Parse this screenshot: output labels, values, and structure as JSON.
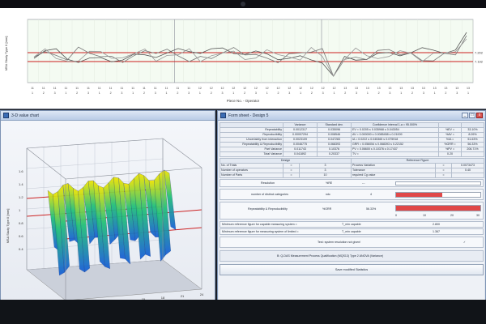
{
  "top_chart": {
    "ylabel": "MSA Study Type II [mm]",
    "xlabel": "Piece No. - Operator",
    "limit_labels": [
      "7.202",
      "7.192"
    ],
    "tick_labels": [
      "11",
      "11",
      "11",
      "11",
      "11",
      "11",
      "11",
      "11",
      "11",
      "11",
      "11",
      "11",
      "11",
      "11",
      "11",
      "12",
      "12",
      "12",
      "12",
      "12",
      "12",
      "12",
      "12",
      "12",
      "12",
      "12",
      "12",
      "12",
      "13",
      "13",
      "13",
      "13",
      "13",
      "13",
      "13",
      "13",
      "13",
      "13",
      "13",
      "13"
    ]
  },
  "left_window": {
    "title": "3-D value chart",
    "zlabel": "MSA Study Type II [mm]",
    "xlabel": "Value No. →",
    "z_ticks": [
      "1.6",
      "1.4",
      "1.2",
      "1",
      "0.8",
      "0.6",
      "0.4"
    ],
    "x_ticks": [
      "3",
      "6",
      "9",
      "12",
      "15",
      "18",
      "21",
      "24"
    ]
  },
  "right_window": {
    "title": "Form sheet - Design 5",
    "controls": [
      "_",
      "□",
      "x"
    ],
    "stats_headers": [
      "",
      "Variance",
      "Standard dev.",
      "Confidence interval    1-a  =   95.000%",
      "",
      ""
    ],
    "stats_rows": [
      [
        "Repeatability",
        "0.0012317",
        "0.035096",
        "EV  =  0.0205 ≤ 0.035968 ≤ 0.043054",
        "%EV  =",
        "33.10%"
      ],
      [
        "Reproducibility",
        "0.00007294",
        "0.008546",
        "AV  =  0.000000 ≤ 0.0085458 ≤ 0.21009",
        "%AV  =",
        "8.09%"
      ],
      [
        "Uncertainty from interaction",
        "0.0023109",
        "0.047283",
        "IA  =  0.0222 ≤ 0.045365 ≤ 0.075918",
        "%IA  =",
        "51.63%"
      ],
      [
        "Repeatability & Reproducibility",
        "0.0046775",
        "0.068393",
        "GRR = 0.056054 ≤ 0.068393 ≤ 0.22152",
        "%GRR =",
        "56.33%"
      ],
      [
        "Part Variance",
        "0.011743",
        "0.10376",
        "PV  =  0.06600 ≤ 0.10376 ≤ 0.17437",
        "%PV  =",
        "206.71%"
      ],
      [
        "Total Variance",
        "0.041892",
        "0.20337",
        "TV  =",
        "0.20",
        ""
      ]
    ],
    "design_header": "Design",
    "reference_header": "Reference Figure",
    "design_rows": [
      [
        "No. of Trials",
        "=",
        "3",
        "Process Variation",
        "=",
        "0.0073473"
      ],
      [
        "Number of operators",
        "=",
        "3",
        "Tolerance",
        "=",
        "0.40"
      ],
      [
        "Number of Parts",
        "=",
        "10",
        "required Cg value",
        "=",
        ""
      ]
    ],
    "resolution_label": "Resolution",
    "resolution_key": "%RE",
    "resolution_value": "---",
    "ndc_label": "number of distinct categories",
    "ndc_key": "ndc",
    "ndc_value": "4",
    "ndc_fill": 0.55,
    "grr_label": "Repeatability & Reproducibility",
    "grr_key": "%GRR",
    "grr_value": "56.33%",
    "grr_fill": 1.0,
    "scale_ticks": [
      "0",
      "10",
      "20",
      "30"
    ],
    "min_ref_1": "Minimum reference figure for capable measuring system  =",
    "min_ref_1_key": "T_min capable",
    "min_ref_1_value": "2.800",
    "min_ref_2": "Minimum reference figure for measuring system of limited  =",
    "min_ref_2_key": "T_min capable",
    "min_ref_2_value": "1.367",
    "test_label": "Test: system resolution not given!",
    "test_check": "✓",
    "footer_label": "B: Q-DAS Measurement Process Qualification (MQS13)  Type 2  ANOVA (Variance)",
    "button_label": "Save modified Statistics"
  },
  "colors": {
    "limit_line": "#cc1f1f",
    "series": [
      "#555555",
      "#777777",
      "#999999"
    ],
    "surface_top": "#f2e500",
    "surface_mid": "#22c07a",
    "surface_low": "#1a5fd8"
  }
}
